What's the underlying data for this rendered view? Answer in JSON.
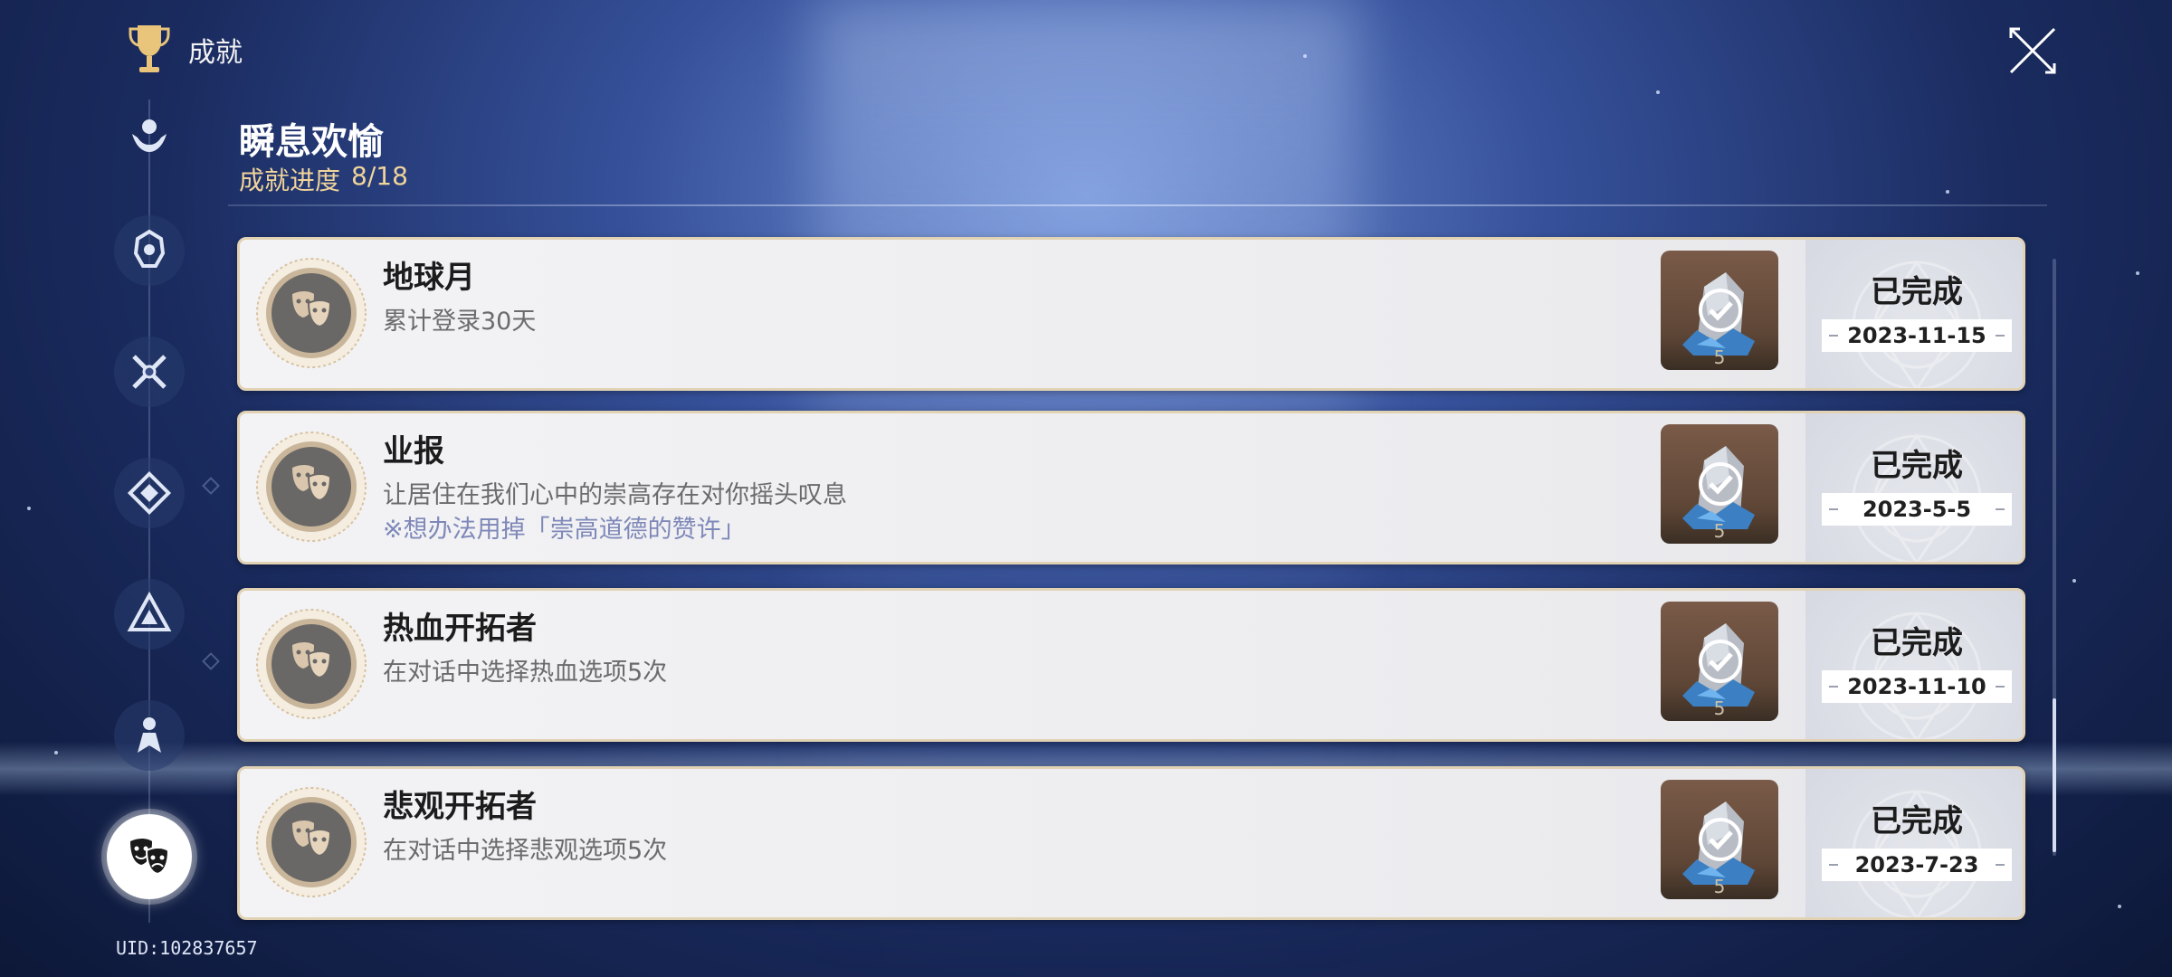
{
  "header": {
    "title": "成就"
  },
  "section": {
    "title": "瞬息欢愉",
    "progress_label": "成就进度",
    "progress_value": "8/18"
  },
  "uid": "UID:102837657",
  "sidebar": {
    "items": [
      {
        "icon": "hands-emblem-icon",
        "active": false
      },
      {
        "icon": "helmet-emblem-icon",
        "active": false
      },
      {
        "icon": "crossed-swords-icon",
        "active": false
      },
      {
        "icon": "diamond-emblem-icon",
        "active": false
      },
      {
        "icon": "triangle-emblem-icon",
        "active": false
      },
      {
        "icon": "figure-emblem-icon",
        "active": false
      },
      {
        "icon": "theater-masks-icon",
        "active": true
      }
    ]
  },
  "achievements": [
    {
      "title": "地球月",
      "desc": "累计登录30天",
      "note": "",
      "reward_count": "5",
      "status": "已完成",
      "date": "2023-11-15"
    },
    {
      "title": "业报",
      "desc": "让居住在我们心中的崇高存在对你摇头叹息",
      "note": "※想办法用掉「崇高道德的赞许」",
      "reward_count": "5",
      "status": "已完成",
      "date": "2023-5-5"
    },
    {
      "title": "热血开拓者",
      "desc": "在对话中选择热血选项5次",
      "note": "",
      "reward_count": "5",
      "status": "已完成",
      "date": "2023-11-10"
    },
    {
      "title": "悲观开拓者",
      "desc": "在对话中选择悲观选项5次",
      "note": "",
      "reward_count": "5",
      "status": "已完成",
      "date": "2023-7-23"
    }
  ],
  "colors": {
    "progress": "#f0d49a",
    "card_border": "#e1d2b4",
    "note": "#7e88b8"
  }
}
